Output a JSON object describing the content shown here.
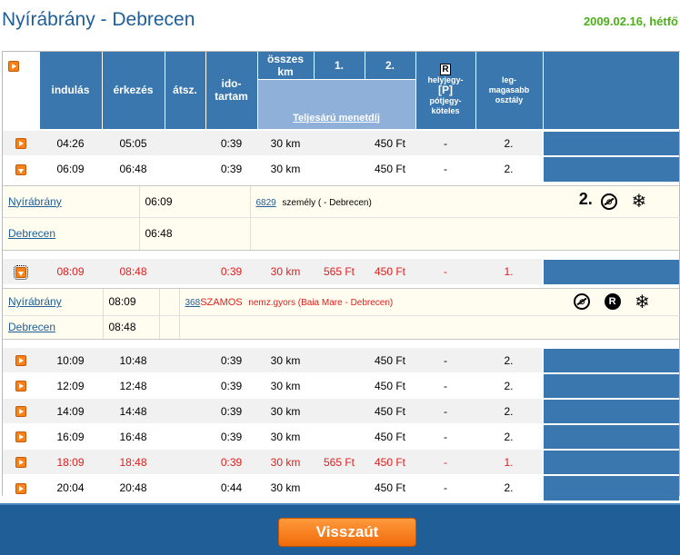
{
  "header": {
    "title": "Nyírábrány - Debrecen",
    "date": "2009.02.16, hétfő"
  },
  "table_header": {
    "departure": "indulás",
    "arrival": "érkezés",
    "transfer": "átsz.",
    "duration_1": "ido-",
    "duration_2": "tartam",
    "total_km_1": "összes",
    "total_km_2": "km",
    "class1": "1.",
    "class2": "2.",
    "fare_label": "Teljesárú menetdíj",
    "seat_symbol": "R",
    "seat_1": "helyjegy-",
    "seat_2": "[P]",
    "seat_3": "pótjegy-",
    "seat_4": "köteles",
    "highest_1": "leg-",
    "highest_2": "magasabb",
    "highest_3": "osztály"
  },
  "trips": [
    {
      "dep": "04:26",
      "arr": "05:05",
      "transfer": "",
      "dur": "0:39",
      "km": "30 km",
      "c1": "",
      "c2": "450 Ft",
      "seat": "-",
      "cls": "2."
    },
    {
      "dep": "06:09",
      "arr": "06:48",
      "transfer": "",
      "dur": "0:39",
      "km": "30 km",
      "c1": "",
      "c2": "450 Ft",
      "seat": "-",
      "cls": "2."
    },
    {
      "dep": "08:09",
      "arr": "08:48",
      "transfer": "",
      "dur": "0:39",
      "km": "30 km",
      "c1": "565 Ft",
      "c2": "450 Ft",
      "seat": "-",
      "cls": "1."
    },
    {
      "dep": "10:09",
      "arr": "10:48",
      "transfer": "",
      "dur": "0:39",
      "km": "30 km",
      "c1": "",
      "c2": "450 Ft",
      "seat": "-",
      "cls": "2."
    },
    {
      "dep": "12:09",
      "arr": "12:48",
      "transfer": "",
      "dur": "0:39",
      "km": "30 km",
      "c1": "",
      "c2": "450 Ft",
      "seat": "-",
      "cls": "2."
    },
    {
      "dep": "14:09",
      "arr": "14:48",
      "transfer": "",
      "dur": "0:39",
      "km": "30 km",
      "c1": "",
      "c2": "450 Ft",
      "seat": "-",
      "cls": "2."
    },
    {
      "dep": "16:09",
      "arr": "16:48",
      "transfer": "",
      "dur": "0:39",
      "km": "30 km",
      "c1": "",
      "c2": "450 Ft",
      "seat": "-",
      "cls": "2."
    },
    {
      "dep": "18:09",
      "arr": "18:48",
      "transfer": "",
      "dur": "0:39",
      "km": "30 km",
      "c1": "565 Ft",
      "c2": "450 Ft",
      "seat": "-",
      "cls": "1."
    },
    {
      "dep": "20:04",
      "arr": "20:48",
      "transfer": "",
      "dur": "0:44",
      "km": "30 km",
      "c1": "",
      "c2": "450 Ft",
      "seat": "-",
      "cls": "2."
    }
  ],
  "detail1": {
    "from": "Nyírábrány",
    "from_time": "06:09",
    "to": "Debrecen",
    "to_time": "06:48",
    "train_no": "6829",
    "train_desc": "személy ( - Debrecen)",
    "class_mark": "2.",
    "icon1": "no-smoking-icon",
    "icon2": "snowflake-icon"
  },
  "detail2": {
    "from": "Nyírábrány",
    "from_time": "08:09",
    "to": "Debrecen",
    "to_time": "08:48",
    "train_no": "368",
    "train_name": "SZAMOS",
    "train_desc": "nemz.gyors (Baia Mare - Debrecen)",
    "icon1": "no-smoking-icon",
    "icon2": "reservation-icon",
    "icon2_letter": "R",
    "icon3": "snowflake-icon"
  },
  "footer": {
    "back_label": "Visszaút"
  },
  "colors": {
    "header_blue": "#3a77ae",
    "title_blue": "#1f5e96",
    "date_green": "#4caf18",
    "highlight_red": "#e11d1d",
    "button_orange": "#f7821b",
    "detail_bg": "#fefdef"
  }
}
